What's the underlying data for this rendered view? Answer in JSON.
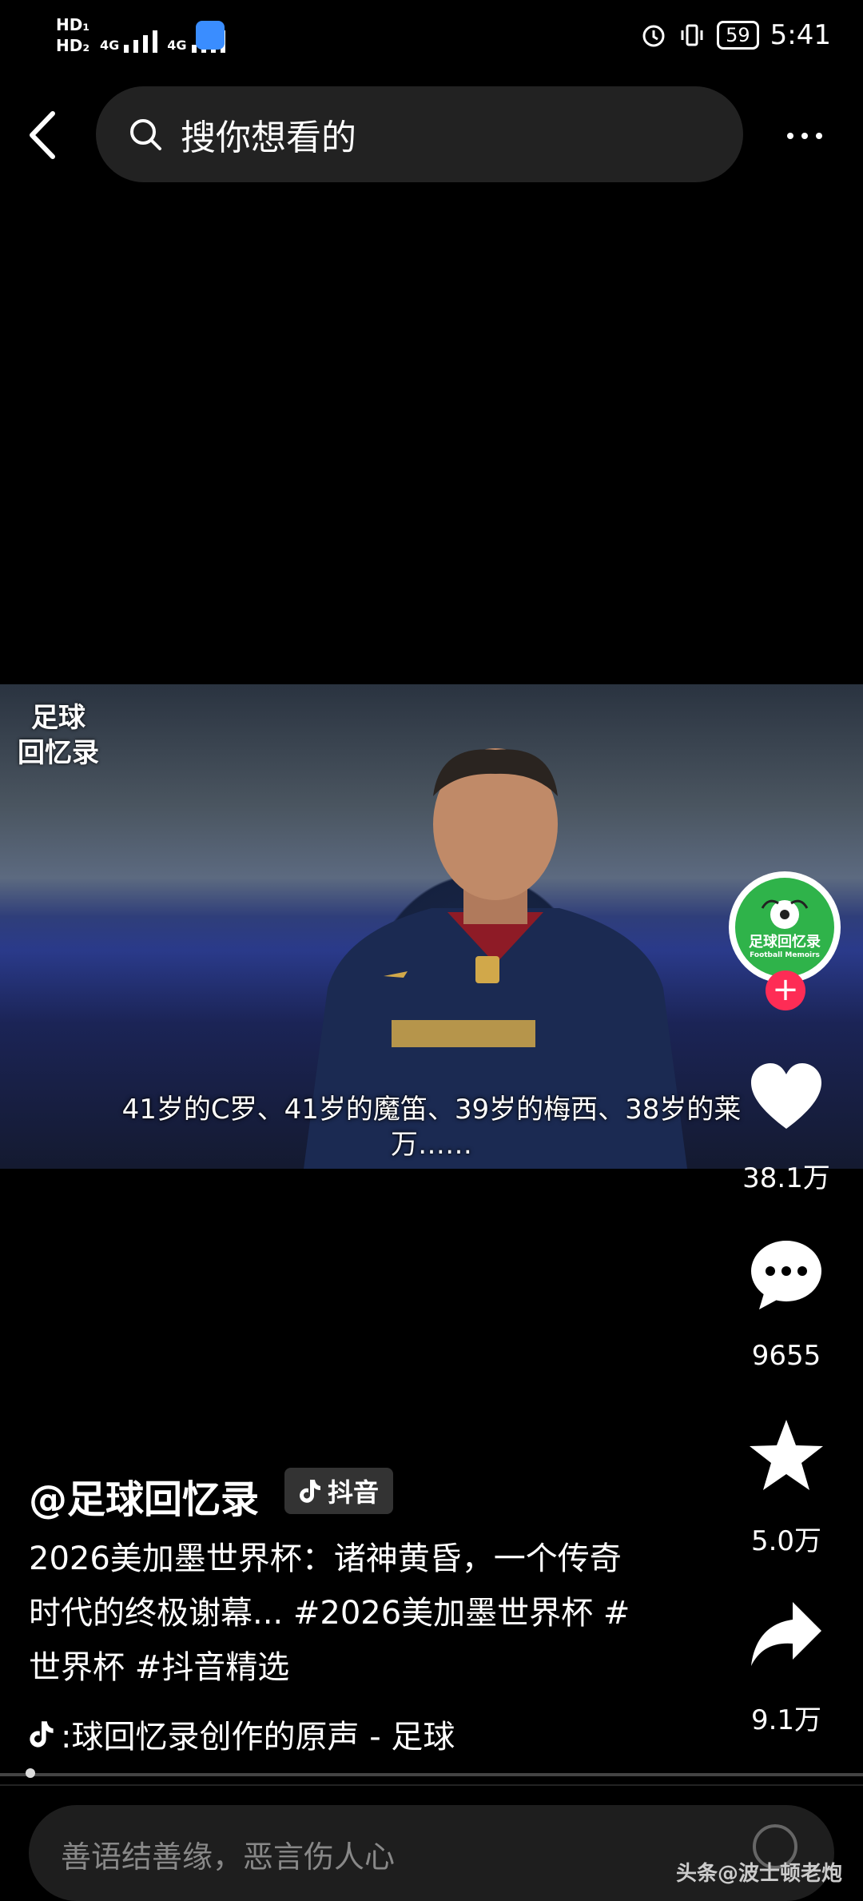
{
  "status_bar": {
    "hd1": "HD₁",
    "hd2": "HD₂",
    "net1": "4G",
    "net2": "4G",
    "battery": "59",
    "time": "5:41"
  },
  "top_bar": {
    "search_placeholder": "搜你想看的"
  },
  "video": {
    "watermark_line1": "足球",
    "watermark_line2": "回忆录",
    "subtitle": "41岁的C罗、41岁的魔笛、39岁的梅西、38岁的莱万……"
  },
  "rail": {
    "avatar_text": "足球回忆录",
    "avatar_sub": "Football Memoirs",
    "likes": "38.1万",
    "comments": "9655",
    "favorites": "5.0万",
    "shares": "9.1万",
    "accent": "#fe2c55"
  },
  "caption": {
    "author": "@足球回忆录",
    "platform_badge": "抖音",
    "description": "2026美加墨世界杯：诸神黄昏，一个传奇时代的终极谢幕... #2026美加墨世界杯 #世界杯 #抖音精选",
    "music": ":球回忆录创作的原声 - 足球"
  },
  "comment_bar": {
    "placeholder": "善语结善缘，恶言伤人心"
  },
  "watermark": "头条@波士顿老炮"
}
